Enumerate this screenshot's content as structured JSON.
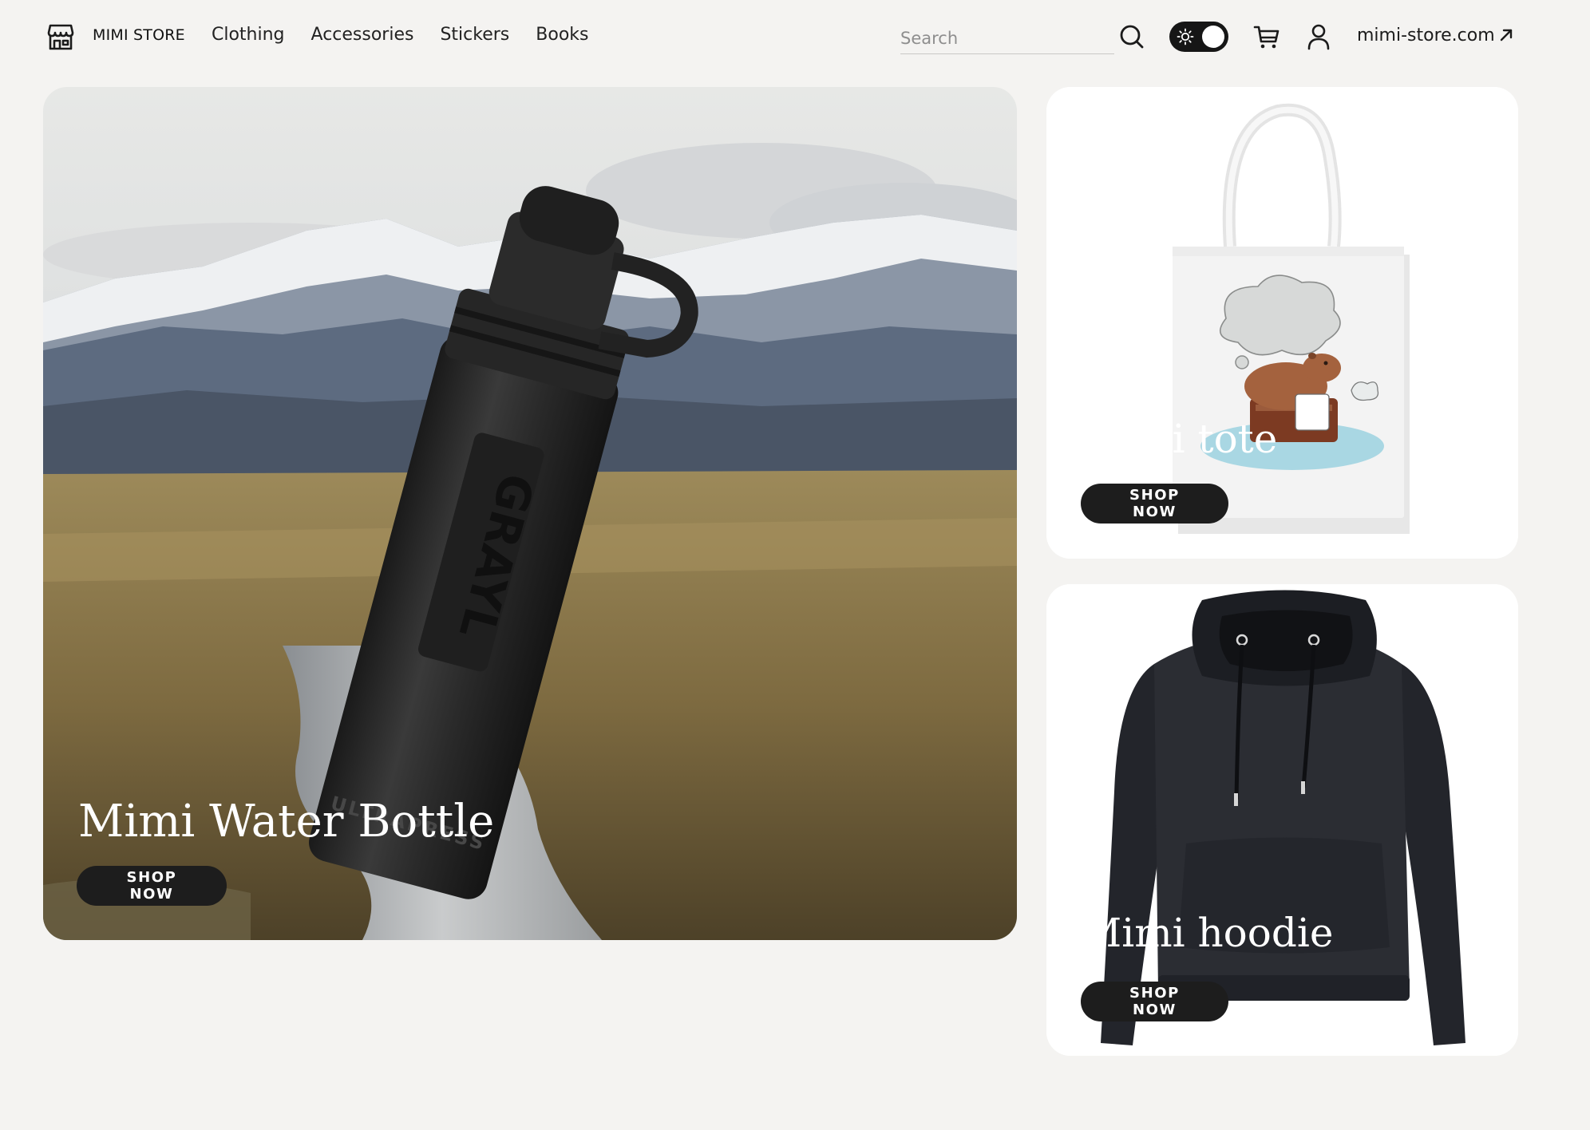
{
  "header": {
    "brand": "MIMI STORE",
    "nav": [
      "Clothing",
      "Accessories",
      "Stickers",
      "Books"
    ],
    "search": {
      "placeholder": "Search",
      "value": ""
    },
    "theme_toggle": {
      "state": "dark"
    },
    "external_link": "mimi-store.com"
  },
  "cards": {
    "hero": {
      "title": "Mimi Water Bottle",
      "button": "SHOP NOW",
      "image": "water-bottle-in-mountain-landscape"
    },
    "tote": {
      "title": "Mimi tote",
      "button": "SHOP NOW",
      "image": "white-tote-bag-capybara-print"
    },
    "hoodie": {
      "title": "Mimi hoodie",
      "button": "SHOP NOW",
      "image": "black-hoodie"
    }
  },
  "product_print": {
    "bottle_brand": "GRAYL",
    "bottle_model": "ULTRAPRESS"
  },
  "colors": {
    "page_background": "#f4f3f1",
    "button_background": "#1d1d1d",
    "card_background": "#ffffff"
  },
  "icons": [
    "storefront-icon",
    "search-icon",
    "sun-icon",
    "cart-icon",
    "user-icon",
    "arrow-up-right-icon"
  ]
}
